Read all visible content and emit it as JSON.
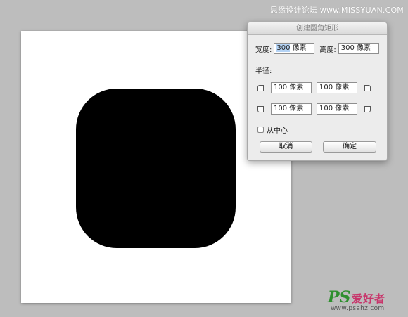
{
  "watermark": {
    "top_text": "思缘设计论坛  www.MISSYUAN.COM",
    "logo_ps": "PS",
    "logo_name": "爱好者",
    "logo_url": "www.psahz.com"
  },
  "canvas": {
    "shape_color": "#000000",
    "background": "#ffffff"
  },
  "dialog": {
    "title": "创建圆角矩形",
    "width_label": "宽度:",
    "width_value_selected": "300",
    "width_unit": " 像素",
    "height_label": "高度:",
    "height_value": "300 像素",
    "radius_label": "半径:",
    "radius_top_left": "100 像素",
    "radius_top_right": "100 像素",
    "radius_bottom_left": "100 像素",
    "radius_bottom_right": "100 像素",
    "from_center_label": "从中心",
    "from_center_checked": false,
    "cancel_label": "取消",
    "ok_label": "确定"
  }
}
